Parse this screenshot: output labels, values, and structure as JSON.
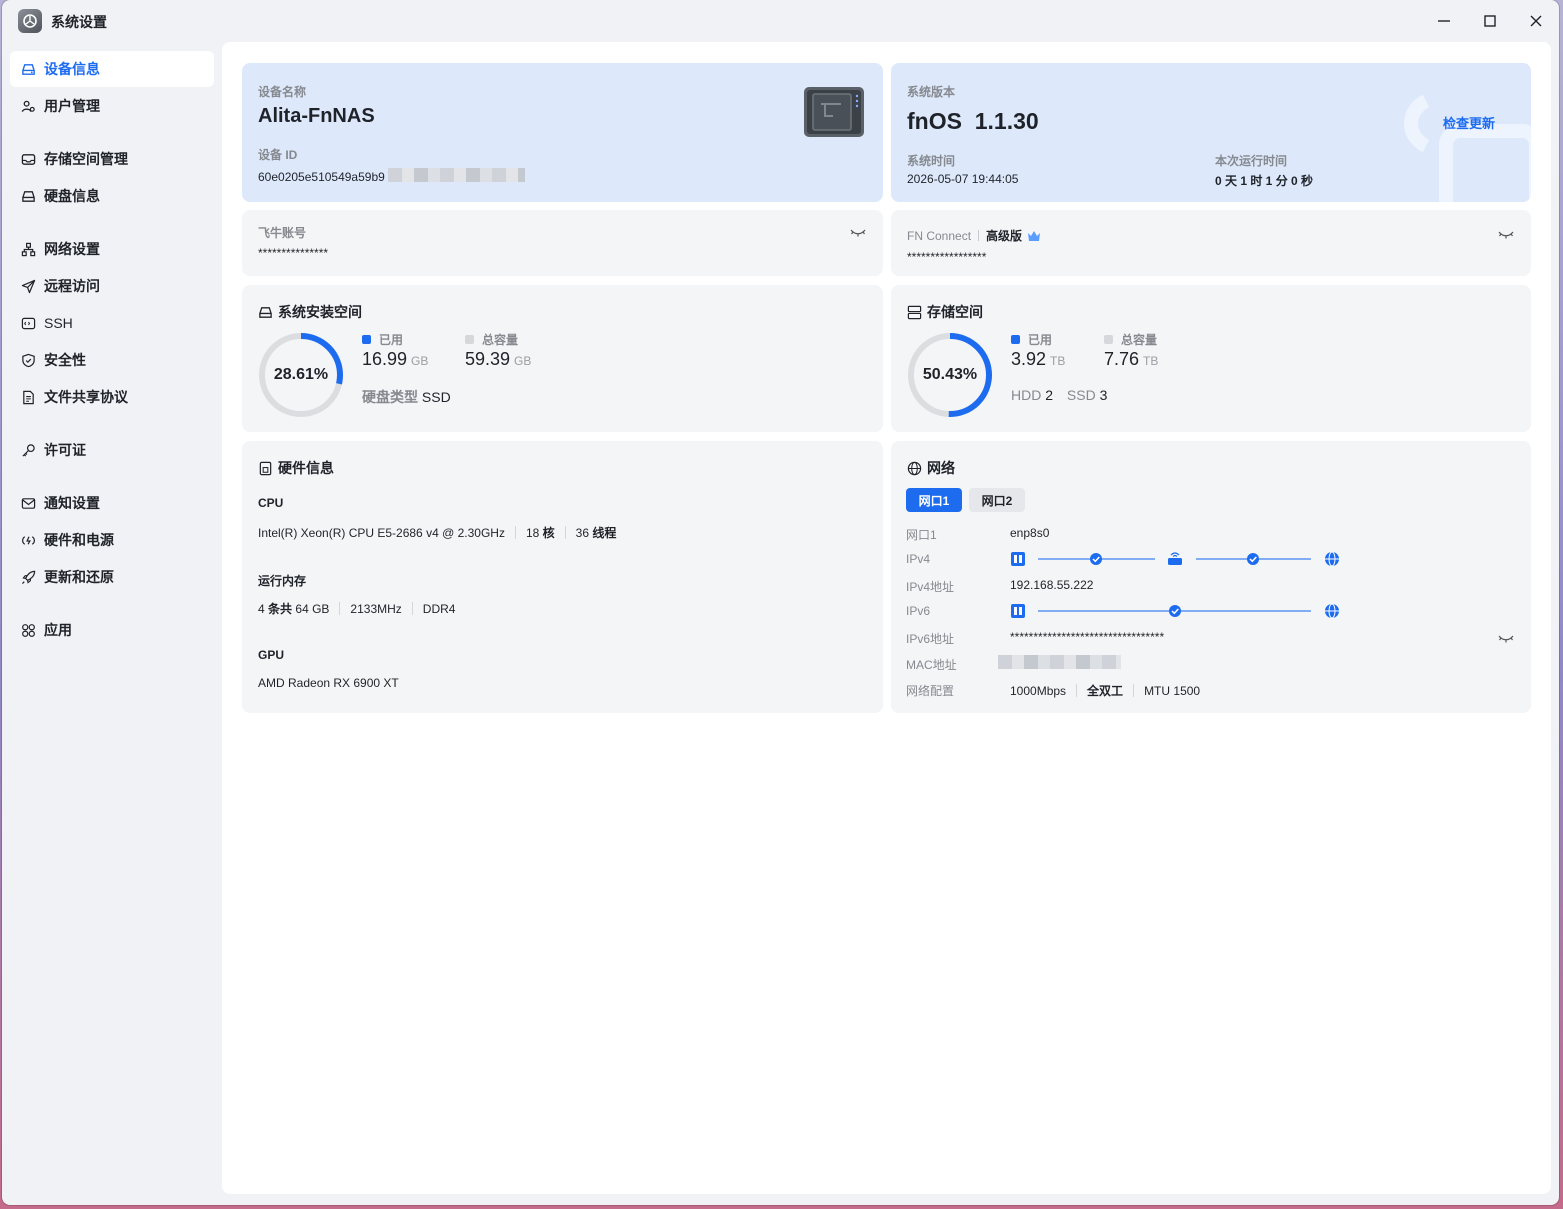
{
  "window": {
    "title": "系统设置"
  },
  "sidebar": {
    "items": [
      {
        "label": "设备信息",
        "icon": "drive-icon",
        "active": true
      },
      {
        "label": "用户管理",
        "icon": "users-icon"
      },
      {
        "label": "存储空间管理",
        "icon": "storage-icon"
      },
      {
        "label": "硬盘信息",
        "icon": "disk-icon"
      },
      {
        "label": "网络设置",
        "icon": "network-icon"
      },
      {
        "label": "远程访问",
        "icon": "send-icon"
      },
      {
        "label": "SSH",
        "icon": "terminal-icon"
      },
      {
        "label": "安全性",
        "icon": "shield-icon"
      },
      {
        "label": "文件共享协议",
        "icon": "document-icon"
      },
      {
        "label": "许可证",
        "icon": "key-icon"
      },
      {
        "label": "通知设置",
        "icon": "mail-icon"
      },
      {
        "label": "硬件和电源",
        "icon": "power-icon"
      },
      {
        "label": "更新和还原",
        "icon": "rocket-icon"
      },
      {
        "label": "应用",
        "icon": "apps-icon"
      }
    ]
  },
  "device": {
    "name_label": "设备名称",
    "name": "Alita-FnNAS",
    "id_label": "设备 ID",
    "id_visible": "60e0205e510549a59b9"
  },
  "system": {
    "version_label": "系统版本",
    "version": "fnOS  1.1.30",
    "check_update": "检查更新",
    "time_label": "系统时间",
    "time": "2026-05-07 19:44:05",
    "uptime_label": "本次运行时间",
    "uptime": "0 天 1 时 1 分 0 秒"
  },
  "feiniu": {
    "label": "飞牛账号",
    "value": "***************"
  },
  "fnconnect": {
    "label": "FN Connect",
    "tier": "高级版",
    "value": "*****************"
  },
  "install_space": {
    "title": "系统安装空间",
    "percent_text": "28.61%",
    "percent": 28.61,
    "used_label": "已用",
    "used": "16.99",
    "used_unit": "GB",
    "total_label": "总容量",
    "total": "59.39",
    "total_unit": "GB",
    "disk_type_label": "硬盘类型",
    "disk_type": "SSD"
  },
  "storage_space": {
    "title": "存储空间",
    "percent_text": "50.43%",
    "percent": 50.43,
    "used_label": "已用",
    "used": "3.92",
    "used_unit": "TB",
    "total_label": "总容量",
    "total": "7.76",
    "total_unit": "TB",
    "hdd_label": "HDD",
    "hdd": "2",
    "ssd_label": "SSD",
    "ssd": "3"
  },
  "hardware": {
    "title": "硬件信息",
    "cpu_label": "CPU",
    "cpu_model": "Intel(R) Xeon(R) CPU E5-2686 v4 @ 2.30GHz",
    "cpu_cores": "18",
    "cpu_cores_unit": "核",
    "cpu_threads": "36",
    "cpu_threads_unit": "线程",
    "ram_label": "运行内存",
    "ram_count": "4",
    "ram_count_unit": "条共",
    "ram_size": "64 GB",
    "ram_speed": "2133MHz",
    "ram_type": "DDR4",
    "gpu_label": "GPU",
    "gpu_model": "AMD Radeon RX 6900 XT"
  },
  "network": {
    "title": "网络",
    "tabs": [
      "网口1",
      "网口2"
    ],
    "port_label": "网口1",
    "port": "enp8s0",
    "ipv4_label": "IPv4",
    "ipv4_addr_label": "IPv4地址",
    "ipv4_addr": "192.168.55.222",
    "ipv6_label": "IPv6",
    "ipv6_addr_label": "IPv6地址",
    "ipv6_addr": "*********************************",
    "mac_label": "MAC地址",
    "config_label": "网络配置",
    "speed": "1000Mbps",
    "duplex": "全双工",
    "mtu": "MTU 1500"
  },
  "colors": {
    "accent": "#1d6cf0",
    "ring_track": "#dcdde0",
    "card": "#f4f5f7",
    "card_blue": "#dde9fb"
  }
}
